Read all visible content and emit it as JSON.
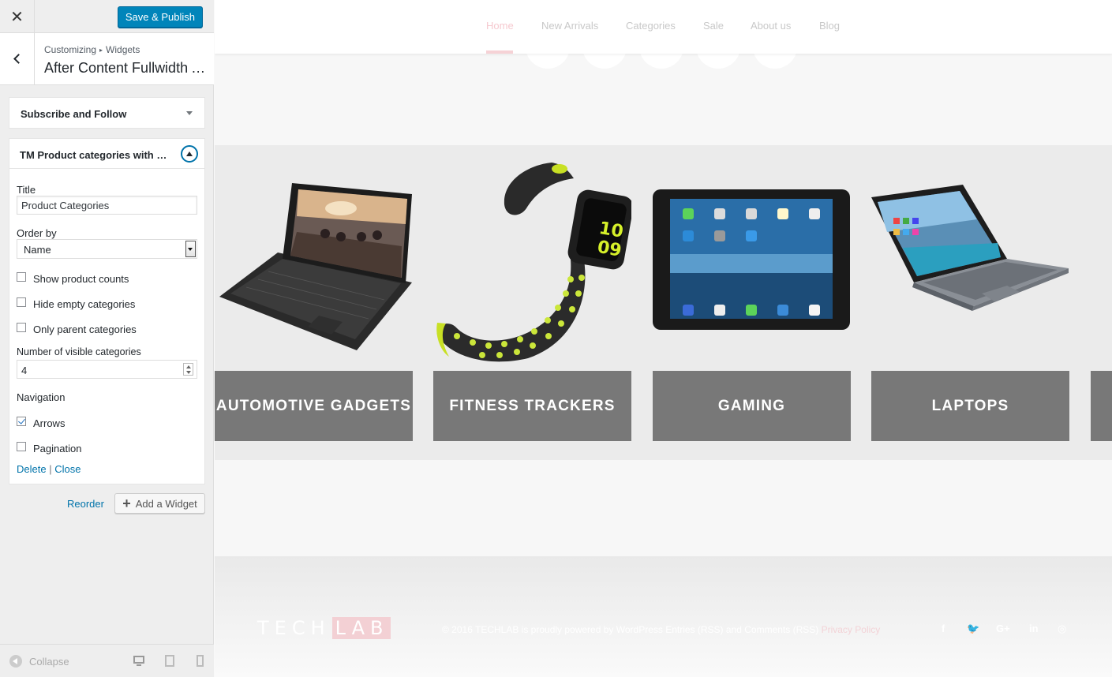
{
  "customizer": {
    "close_icon": "close-icon",
    "save_label": "Save & Publish",
    "breadcrumb": {
      "part1": "Customizing",
      "separator": "▸",
      "part2": "Widgets"
    },
    "section_title": "After Content Fullwidth Area",
    "widgets": [
      {
        "title": "Subscribe and Follow",
        "expanded": false
      },
      {
        "title": "TM Product categories with thumbnails",
        "expanded": true
      }
    ],
    "form": {
      "title_label": "Title",
      "title_value": "Product Categories",
      "order_label": "Order by",
      "order_value": "Name",
      "show_counts_label": "Show product counts",
      "show_counts_checked": false,
      "hide_empty_label": "Hide empty categories",
      "hide_empty_checked": false,
      "only_parent_label": "Only parent categories",
      "only_parent_checked": false,
      "visible_label": "Number of visible categories",
      "visible_value": "4",
      "navigation_label": "Navigation",
      "arrows_label": "Arrows",
      "arrows_checked": true,
      "pagination_label": "Pagination",
      "pagination_checked": false,
      "delete_label": "Delete",
      "action_separator": "|",
      "close_label": "Close"
    },
    "reorder_label": "Reorder",
    "add_widget_label": "Add a Widget",
    "collapse_label": "Collapse",
    "devices": [
      "desktop",
      "tablet",
      "mobile"
    ],
    "accent_color": "#0085ba"
  },
  "preview": {
    "nav": [
      {
        "label": "Home",
        "active": true
      },
      {
        "label": "New Arrivals"
      },
      {
        "label": "Categories"
      },
      {
        "label": "Sale"
      },
      {
        "label": "About us"
      },
      {
        "label": "Blog"
      }
    ],
    "categories": [
      {
        "name": "AUTOMOTIVE GADGETS",
        "image": "laptop-tablet-image"
      },
      {
        "name": "FITNESS TRACKERS",
        "image": "smartwatch-image"
      },
      {
        "name": "GAMING",
        "image": "tablet-image"
      },
      {
        "name": "LAPTOPS",
        "image": "laptop-image"
      }
    ],
    "footer": {
      "logo_part1": "TECH",
      "logo_part2": "LAB",
      "copyright": "© 2016 TECHLAB is proudly powered by WordPress Entries (RSS) and Comments (RSS)",
      "privacy": "Privacy Policy",
      "social": [
        {
          "label": "f",
          "icon": "facebook-icon"
        },
        {
          "label": "🐦",
          "icon": "twitter-icon"
        },
        {
          "label": "G+",
          "icon": "google-plus-icon"
        },
        {
          "label": "in",
          "icon": "linkedin-icon"
        },
        {
          "label": "◎",
          "icon": "pinterest-icon"
        }
      ]
    }
  }
}
